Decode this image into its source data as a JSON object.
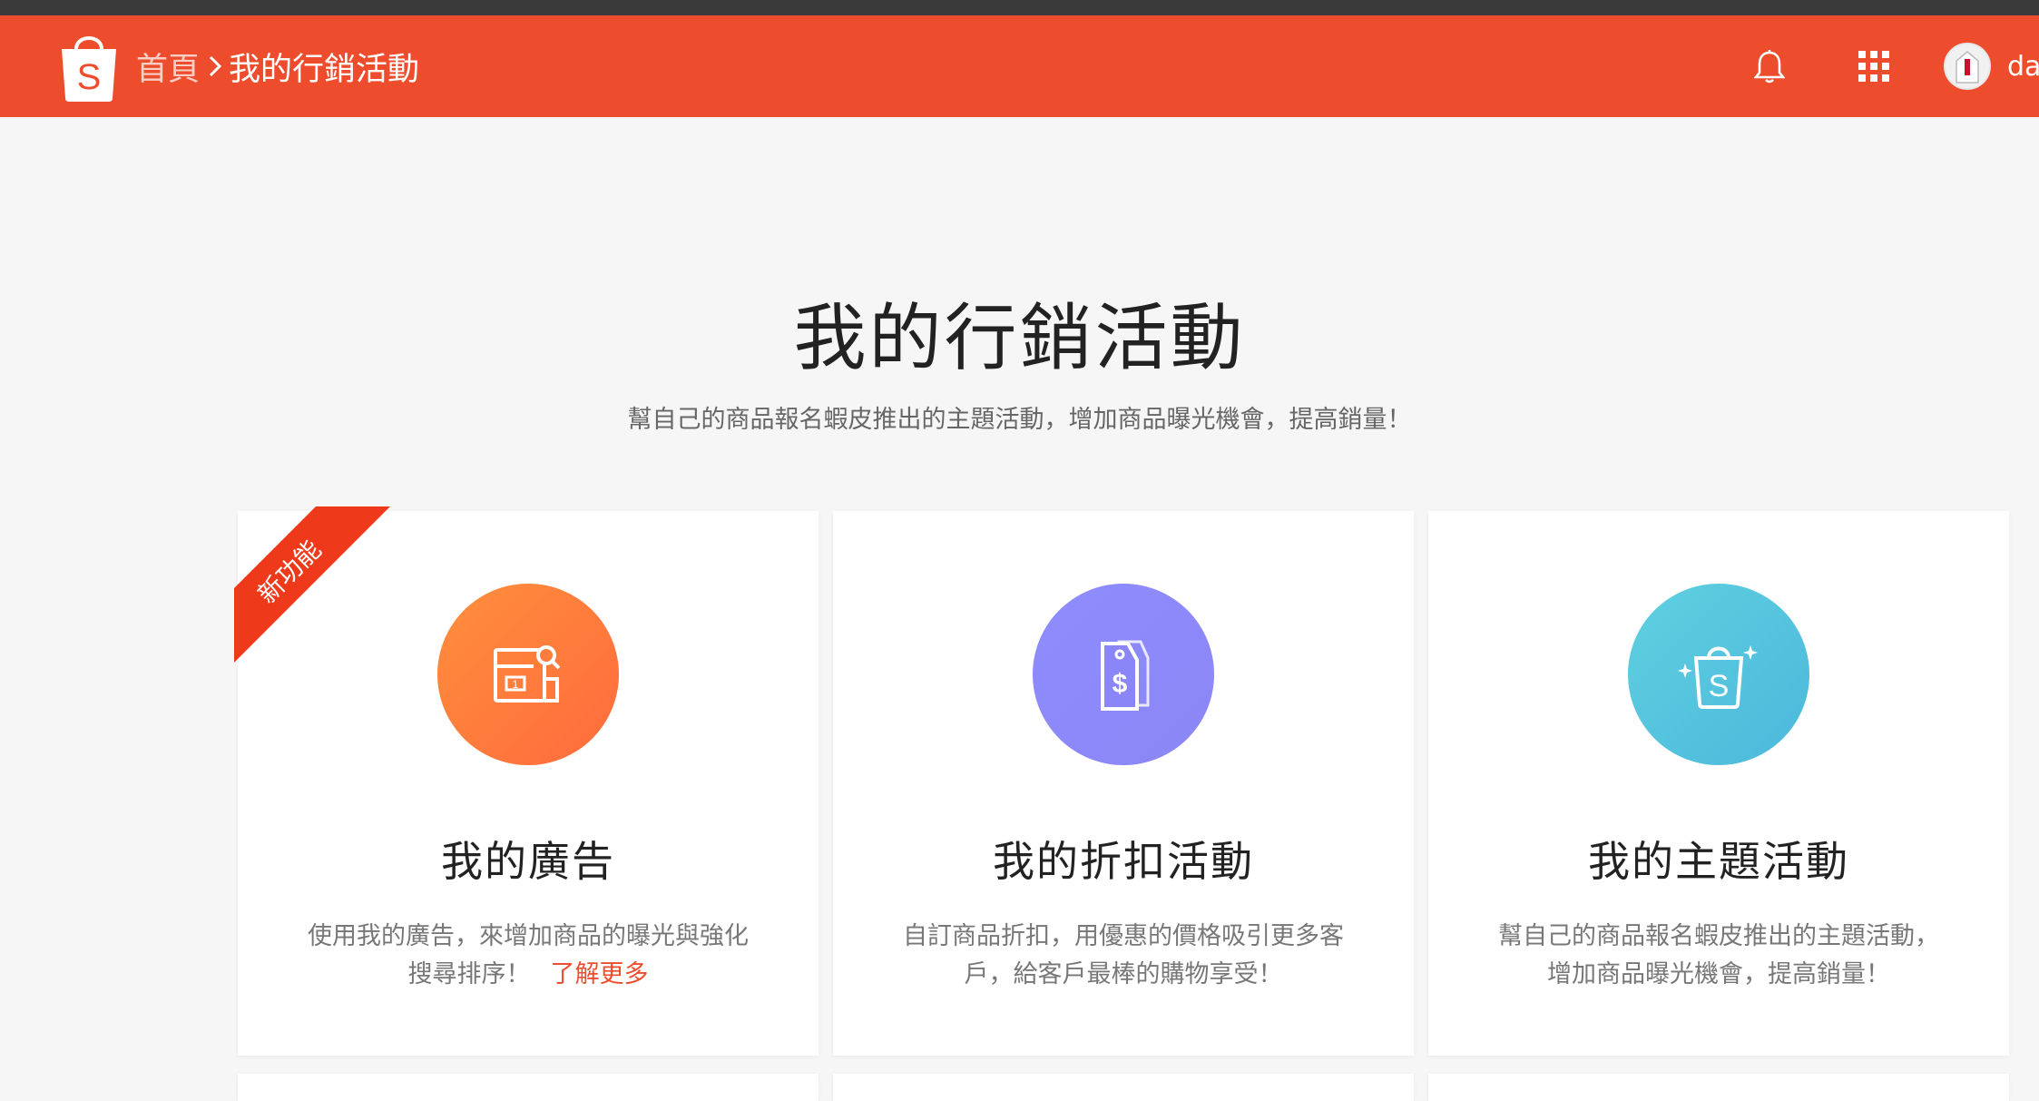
{
  "header": {
    "breadcrumb_home": "首頁",
    "breadcrumb_current": "我的行銷活動",
    "username": "da",
    "notification_icon": "bell-icon",
    "apps_icon": "grid-icon",
    "brand_color": "#ee4d2d"
  },
  "main": {
    "title": "我的行銷活動",
    "subtitle": "幫自己的商品報名蝦皮推出的主題活動，增加商品曝光機會，提高銷量！"
  },
  "cards": [
    {
      "ribbon": "新功能",
      "icon": "ads-search-icon",
      "icon_color": "#ff7a3d",
      "title": "我的廣告",
      "desc_line1": "使用我的廣告，來增加商品的曝光與強化",
      "desc_line2": "搜尋排序！",
      "link": "了解更多"
    },
    {
      "icon": "price-tag-icon",
      "icon_color": "#8b88fa",
      "title": "我的折扣活動",
      "desc_line1": "自訂商品折扣，用優惠的價格吸引更多客",
      "desc_line2": "戶，給客戶最棒的購物享受！"
    },
    {
      "icon": "shopping-bag-icon",
      "icon_color": "#55c4de",
      "title": "我的主題活動",
      "desc_line1": "幫自己的商品報名蝦皮推出的主題活動，",
      "desc_line2": "增加商品曝光機會，提高銷量！"
    }
  ]
}
